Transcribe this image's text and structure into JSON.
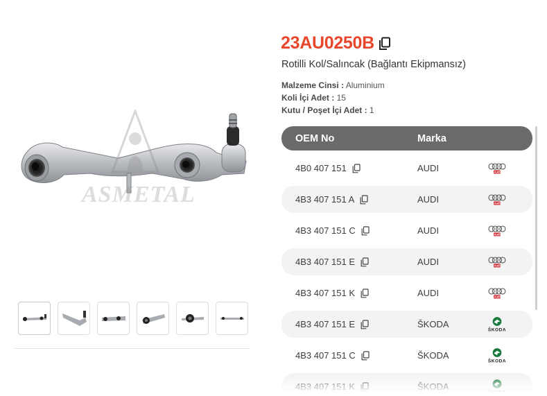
{
  "product": {
    "sku": "23AU0250B",
    "title": "Rotilli Kol/Salıncak (Bağlantı Ekipmansız)",
    "watermark": "ASMETAL",
    "specs": [
      {
        "key": "Malzeme Cinsi :",
        "value": "Aluminium"
      },
      {
        "key": "Koli İçi Adet :",
        "value": "15"
      },
      {
        "key": "Kutu / Poşet İçi Adet :",
        "value": "1"
      }
    ],
    "thumbnail_count": 6
  },
  "oem_table": {
    "headers": {
      "oem": "OEM No",
      "brand": "Marka"
    },
    "rows": [
      {
        "code": "4B0 407 151",
        "brand": "AUDI",
        "logo": "audi-logo"
      },
      {
        "code": "4B3 407 151 A",
        "brand": "AUDI",
        "logo": "audi-logo"
      },
      {
        "code": "4B3 407 151 C",
        "brand": "AUDI",
        "logo": "audi-logo"
      },
      {
        "code": "4B3 407 151 E",
        "brand": "AUDI",
        "logo": "audi-logo"
      },
      {
        "code": "4B3 407 151 K",
        "brand": "AUDI",
        "logo": "audi-logo"
      },
      {
        "code": "4B3 407 151 E",
        "brand": "ŠKODA",
        "logo": "skoda-logo"
      },
      {
        "code": "4B3 407 151 C",
        "brand": "ŠKODA",
        "logo": "skoda-logo"
      },
      {
        "code": "4B3 407 151 K",
        "brand": "ŠKODA",
        "logo": "skoda-logo"
      }
    ]
  },
  "logos": {
    "audi": "Audi",
    "skoda": "ŠKODA"
  },
  "colors": {
    "accent": "#e8472b",
    "header": "#6a6a6a",
    "row_alt": "#f3f3f3",
    "audi_red": "#cc1f2a",
    "skoda_green": "#1a7a3c"
  }
}
